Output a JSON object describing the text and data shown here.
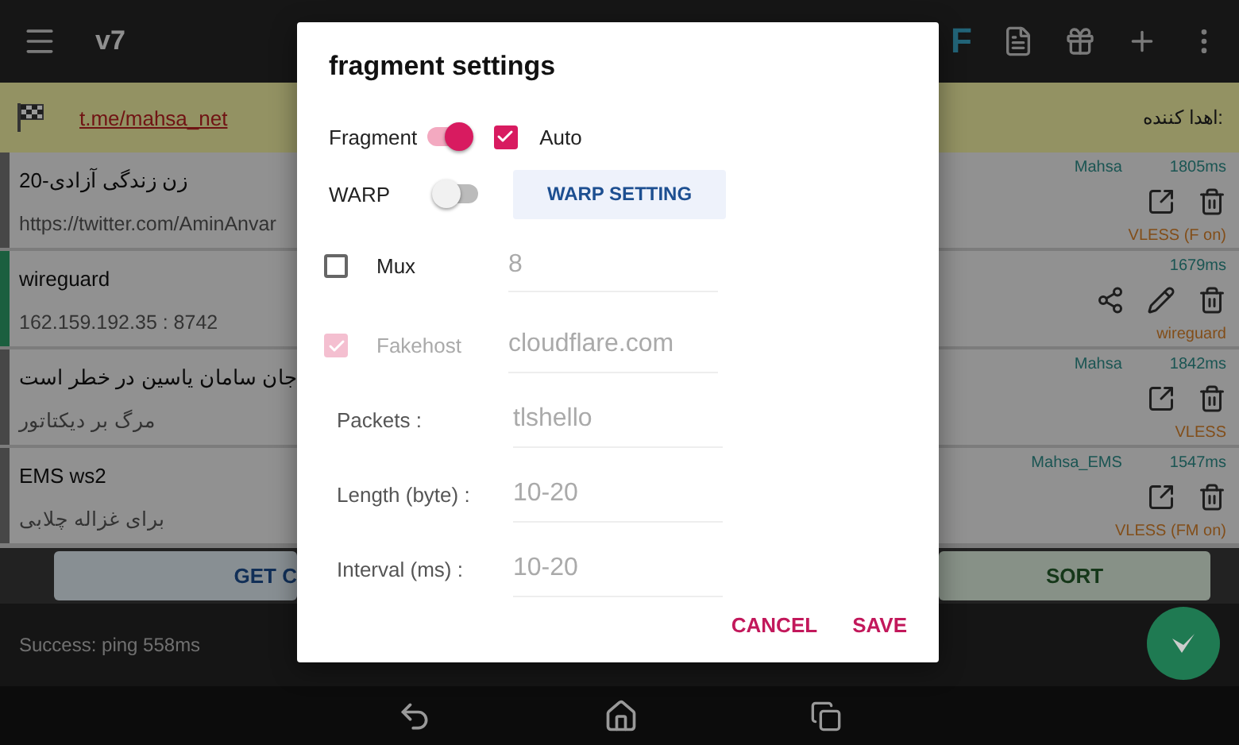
{
  "app_bar": {
    "title": "v7",
    "mode_letter": "F"
  },
  "banner": {
    "link": "t.me/mahsa_net",
    "label": "اهدا کننده:"
  },
  "servers": [
    {
      "kind": "link",
      "title": "زن زندگی آزادی-20",
      "subtitle": "https://twitter.com/AminAnvar",
      "group": "Mahsa",
      "ping": "1805ms",
      "type": "VLESS (F on)",
      "selected": false
    },
    {
      "kind": "editable",
      "title": "wireguard",
      "subtitle": "162.159.192.35 : 8742",
      "ping": "1679ms",
      "type": "wireguard",
      "selected": true
    },
    {
      "kind": "link",
      "title": "جان سامان یاسین در خطر است",
      "subtitle": "مرگ بر دیکتاتور",
      "group": "Mahsa",
      "ping": "1842ms",
      "type": "VLESS",
      "selected": false
    },
    {
      "kind": "link",
      "title": "EMS ws2",
      "subtitle": "برای غزاله چلابی",
      "group": "Mahsa_EMS",
      "ping": "1547ms",
      "type": "VLESS (FM on)",
      "selected": false
    }
  ],
  "actions": [
    "GET C",
    "SORT"
  ],
  "status": "Success: ping 558ms",
  "dialog": {
    "title": "fragment settings",
    "fragment": {
      "label": "Fragment",
      "on": true
    },
    "auto": {
      "label": "Auto",
      "checked": true
    },
    "warp": {
      "label": "WARP",
      "on": false
    },
    "warp_button": "WARP SETTING",
    "options": [
      {
        "kind": "checkbox",
        "label": "Mux",
        "checked": false,
        "disabled": false,
        "value": "8"
      },
      {
        "kind": "checkbox",
        "label": "Fakehost",
        "checked": true,
        "disabled": true,
        "value": "cloudflare.com"
      },
      {
        "kind": "field",
        "label": "Packets :",
        "value": "tlshello"
      },
      {
        "kind": "field",
        "label": "Length (byte) :",
        "value": "10-20"
      },
      {
        "kind": "field",
        "label": "Interval (ms) :",
        "value": "10-20"
      }
    ],
    "buttons": [
      "CANCEL",
      "SAVE"
    ]
  }
}
